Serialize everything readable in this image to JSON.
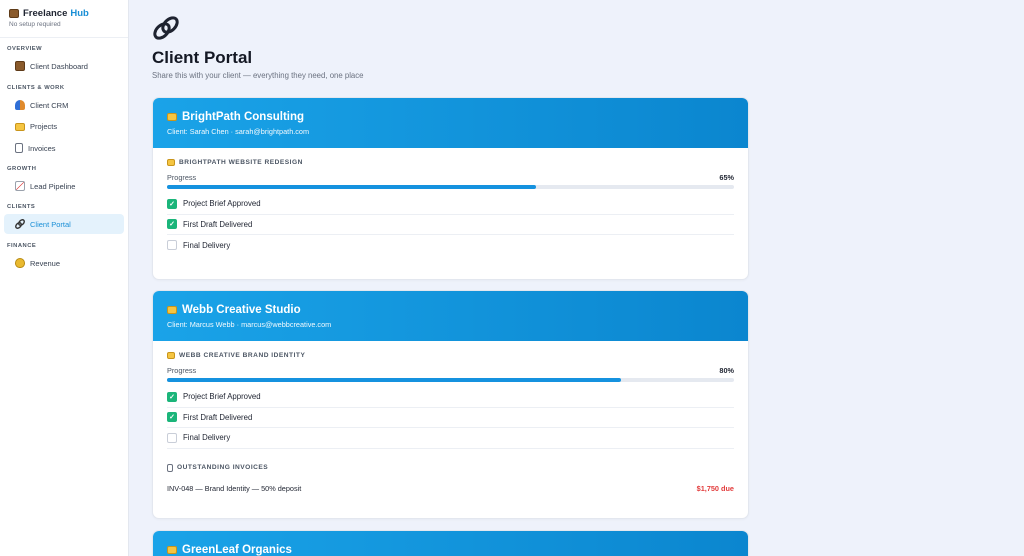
{
  "sidebar": {
    "brand_name": "Freelance",
    "brand_accent": "Hub",
    "brand_sub": "No setup required",
    "sections": [
      {
        "title": "OVERVIEW",
        "items": [
          {
            "label": "Client Dashboard",
            "icon": "briefcase-icon"
          }
        ]
      },
      {
        "title": "CLIENTS & WORK",
        "items": [
          {
            "label": "Client CRM",
            "icon": "people-icon"
          },
          {
            "label": "Projects",
            "icon": "folder-icon"
          },
          {
            "label": "Invoices",
            "icon": "receipt-icon"
          }
        ]
      },
      {
        "title": "GROWTH",
        "items": [
          {
            "label": "Lead Pipeline",
            "icon": "chart-icon"
          }
        ]
      },
      {
        "title": "CLIENTS",
        "items": [
          {
            "label": "Client Portal",
            "icon": "link-icon",
            "active": true
          }
        ]
      },
      {
        "title": "FINANCE",
        "items": [
          {
            "label": "Revenue",
            "icon": "money-bag-icon"
          }
        ]
      }
    ]
  },
  "page": {
    "icon": "link-icon",
    "title": "Client Portal",
    "subtitle": "Share this with your client — everything they need, one place"
  },
  "clients": [
    {
      "name": "BrightPath Consulting",
      "contact": "Client: Sarah Chen · sarah@brightpath.com",
      "project": "BRIGHTPATH WEBSITE REDESIGN",
      "progress_label": "Progress",
      "progress_text": "65%",
      "progress": 0.65,
      "tasks": [
        {
          "label": "Project Brief Approved",
          "done": true
        },
        {
          "label": "First Draft Delivered",
          "done": true
        },
        {
          "label": "Final Delivery",
          "done": false
        }
      ]
    },
    {
      "name": "Webb Creative Studio",
      "contact": "Client: Marcus Webb · marcus@webbcreative.com",
      "project": "WEBB CREATIVE BRAND IDENTITY",
      "progress_label": "Progress",
      "progress_text": "80%",
      "progress": 0.8,
      "tasks": [
        {
          "label": "Project Brief Approved",
          "done": true
        },
        {
          "label": "First Draft Delivered",
          "done": true
        },
        {
          "label": "Final Delivery",
          "done": false
        }
      ],
      "invoices_title": "OUTSTANDING INVOICES",
      "invoices": [
        {
          "description": "INV-048 — Brand Identity — 50% deposit",
          "amount": "$1,750 due"
        }
      ]
    },
    {
      "name": "GreenLeaf Organics"
    }
  ],
  "colors": {
    "accent": "#1a8fd6",
    "header_gradient_start": "#1aa3e8",
    "header_gradient_end": "#0b86cf",
    "check_done": "#1bb57a",
    "due_red": "#e23b3b"
  }
}
